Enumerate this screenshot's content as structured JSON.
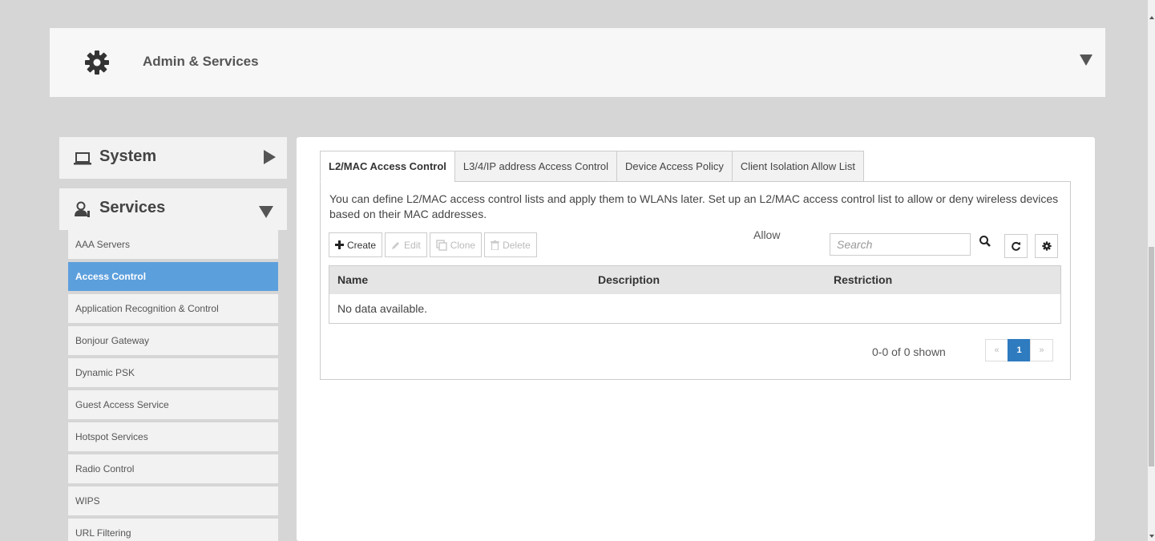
{
  "header": {
    "title": "Admin & Services",
    "icon": "gear-icon"
  },
  "sidebar": {
    "system_label": "System",
    "services_label": "Services",
    "items": [
      {
        "label": "AAA Servers",
        "active": false
      },
      {
        "label": "Access Control",
        "active": true
      },
      {
        "label": "Application Recognition & Control",
        "active": false
      },
      {
        "label": "Bonjour Gateway",
        "active": false
      },
      {
        "label": "Dynamic PSK",
        "active": false
      },
      {
        "label": "Guest Access Service",
        "active": false
      },
      {
        "label": "Hotspot Services",
        "active": false
      },
      {
        "label": "Radio Control",
        "active": false
      },
      {
        "label": "WIPS",
        "active": false
      },
      {
        "label": "URL Filtering",
        "active": false
      }
    ]
  },
  "tabs": [
    {
      "label": "L2/MAC Access Control",
      "active": true
    },
    {
      "label": "L3/4/IP address Access Control",
      "active": false
    },
    {
      "label": "Device Access Policy",
      "active": false
    },
    {
      "label": "Client Isolation Allow List",
      "active": false
    }
  ],
  "main": {
    "description": "You can define L2/MAC access control lists and apply them to WLANs later. Set up an L2/MAC access control list to allow or deny wireless devices based on their MAC addresses.",
    "allow_label": "Allow",
    "search_placeholder": "Search"
  },
  "toolbar": {
    "create": "Create",
    "edit": "Edit",
    "clone": "Clone",
    "delete": "Delete"
  },
  "table": {
    "columns": [
      "Name",
      "Description",
      "Restriction"
    ],
    "empty_text": "No data available."
  },
  "pagination": {
    "info": "0-0 of 0 shown",
    "prev": "«",
    "current": "1",
    "next": "»"
  },
  "colors": {
    "active_menu": "#5c9fdd",
    "current_page": "#2e7bbf",
    "background": "#d6d6d6"
  }
}
